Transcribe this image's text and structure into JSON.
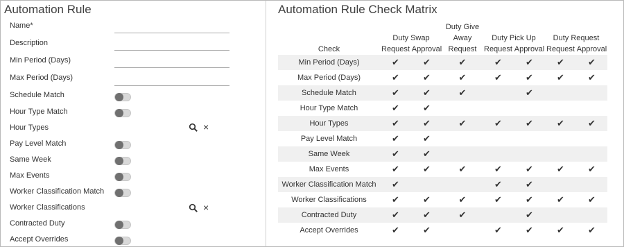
{
  "left": {
    "title": "Automation Rule",
    "fields": [
      {
        "label": "Name*",
        "type": "text"
      },
      {
        "label": "Description",
        "type": "text"
      },
      {
        "label": "Min Period (Days)",
        "type": "text"
      },
      {
        "label": "Max Period (Days)",
        "type": "text"
      },
      {
        "label": "Schedule Match",
        "type": "toggle"
      },
      {
        "label": "Hour Type Match",
        "type": "toggle"
      },
      {
        "label": "Hour Types",
        "type": "lookup"
      },
      {
        "label": "Pay Level Match",
        "type": "toggle"
      },
      {
        "label": "Same Week",
        "type": "toggle"
      },
      {
        "label": "Max Events",
        "type": "toggle"
      },
      {
        "label": "Worker Classification Match",
        "type": "toggle"
      },
      {
        "label": "Worker Classifications",
        "type": "lookup"
      },
      {
        "label": "Contracted Duty",
        "type": "toggle"
      },
      {
        "label": "Accept Overrides",
        "type": "toggle"
      }
    ],
    "icons": {
      "search": "search-icon",
      "clear": "close-icon"
    },
    "clear_glyph": "×"
  },
  "right": {
    "title": "Automation Rule Check Matrix",
    "check_mark": "✔",
    "header_groups": [
      "Duty Swap",
      "Duty Give Away",
      "Duty Pick Up",
      "Duty Request"
    ],
    "header_group_lines": [
      [
        "Duty Swap"
      ],
      [
        "Duty Give",
        "Away"
      ],
      [
        "Duty Pick Up"
      ],
      [
        "Duty Request"
      ]
    ],
    "check_col": "Check",
    "sub_columns": [
      "Request",
      "Approval",
      "Request",
      "Request",
      "Approval",
      "Request",
      "Approval"
    ],
    "rows": [
      {
        "check": "Min Period (Days)",
        "marks": [
          true,
          true,
          true,
          true,
          true,
          true,
          true
        ]
      },
      {
        "check": "Max Period (Days)",
        "marks": [
          true,
          true,
          true,
          true,
          true,
          true,
          true
        ]
      },
      {
        "check": "Schedule Match",
        "marks": [
          true,
          true,
          true,
          false,
          true,
          false,
          false
        ]
      },
      {
        "check": "Hour Type Match",
        "marks": [
          true,
          true,
          false,
          false,
          false,
          false,
          false
        ]
      },
      {
        "check": "Hour Types",
        "marks": [
          true,
          true,
          true,
          true,
          true,
          true,
          true
        ]
      },
      {
        "check": "Pay Level Match",
        "marks": [
          true,
          true,
          false,
          false,
          false,
          false,
          false
        ]
      },
      {
        "check": "Same Week",
        "marks": [
          true,
          true,
          false,
          false,
          false,
          false,
          false
        ]
      },
      {
        "check": "Max Events",
        "marks": [
          true,
          true,
          true,
          true,
          true,
          true,
          true
        ]
      },
      {
        "check": "Worker Classification Match",
        "marks": [
          true,
          false,
          false,
          true,
          true,
          false,
          false
        ]
      },
      {
        "check": "Worker Classifications",
        "marks": [
          true,
          true,
          true,
          true,
          true,
          true,
          true
        ]
      },
      {
        "check": "Contracted Duty",
        "marks": [
          true,
          true,
          true,
          false,
          true,
          false,
          false
        ]
      },
      {
        "check": "Accept Overrides",
        "marks": [
          true,
          true,
          false,
          true,
          true,
          true,
          true
        ]
      }
    ]
  }
}
